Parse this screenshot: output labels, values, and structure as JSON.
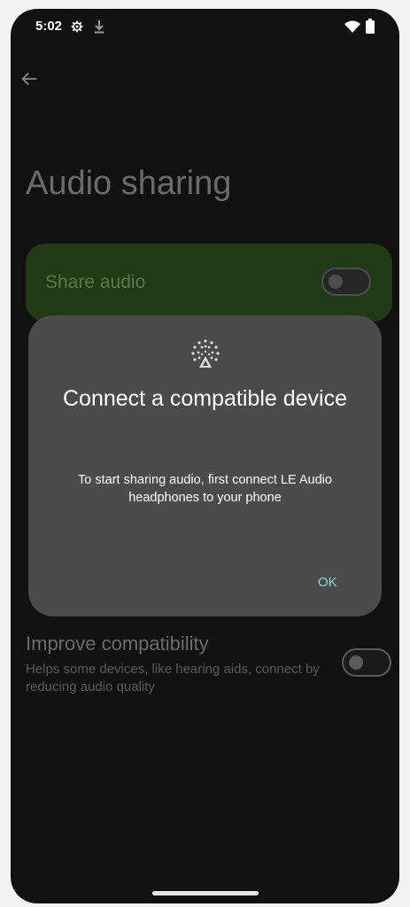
{
  "status_bar": {
    "time": "5:02",
    "icons": [
      "gear-icon",
      "download-icon",
      "wifi-icon",
      "battery-icon"
    ]
  },
  "page": {
    "title": "Audio sharing",
    "share_audio": {
      "label": "Share audio",
      "enabled": false
    },
    "improve_compatibility": {
      "title": "Improve compatibility",
      "description": "Helps some devices, like hearing aids, connect by reducing audio quality",
      "enabled": false
    }
  },
  "dialog": {
    "icon": "audio-sharing-icon",
    "title": "Connect a compatible device",
    "body": "To start sharing audio, first connect LE Audio headphones to your phone",
    "ok_label": "OK"
  },
  "colors": {
    "dialog_bg": "#4b4b4b",
    "accent": "#8fd6d0",
    "share_card": "#1f3a14"
  }
}
